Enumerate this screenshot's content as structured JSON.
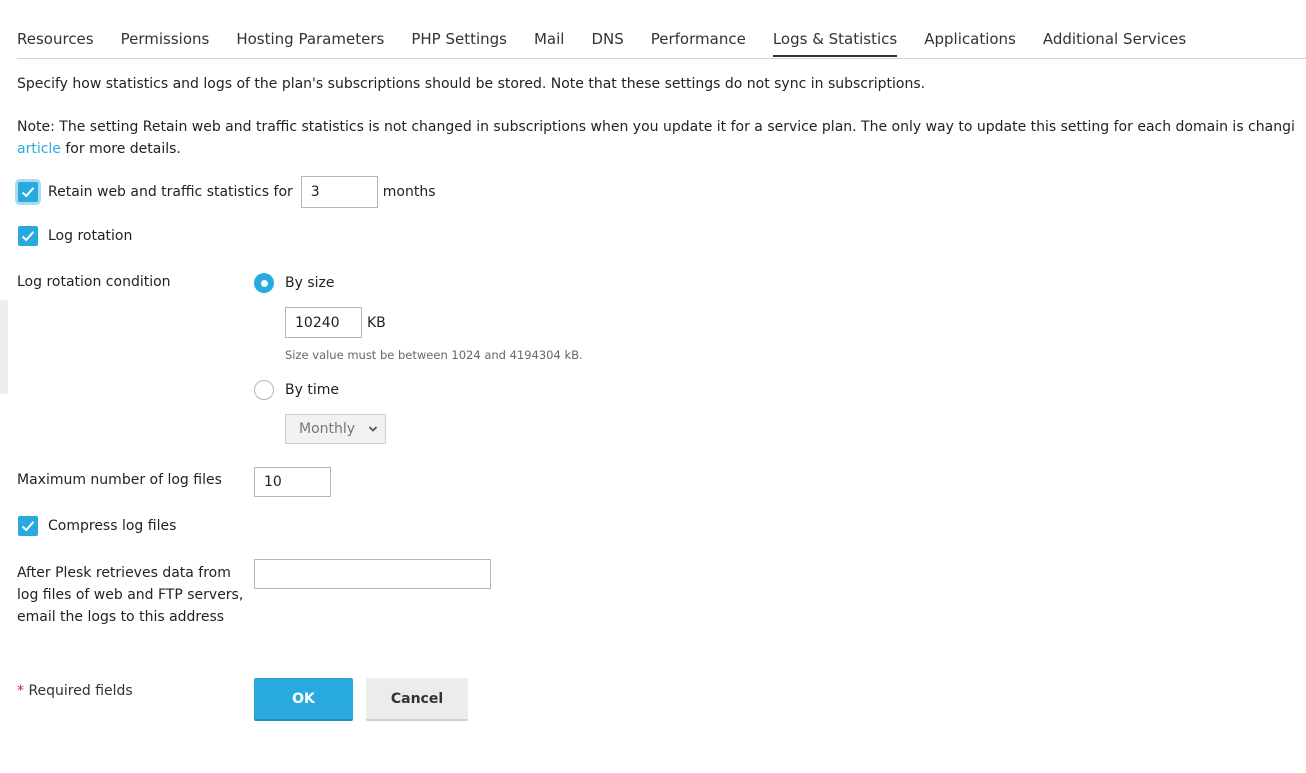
{
  "tabs": [
    {
      "label": "Resources"
    },
    {
      "label": "Permissions"
    },
    {
      "label": "Hosting Parameters"
    },
    {
      "label": "PHP Settings"
    },
    {
      "label": "Mail"
    },
    {
      "label": "DNS"
    },
    {
      "label": "Performance"
    },
    {
      "label": "Logs & Statistics",
      "active": true
    },
    {
      "label": "Applications"
    },
    {
      "label": "Additional Services"
    }
  ],
  "intro": "Specify how statistics and logs of the plan's subscriptions should be stored. Note that these settings do not sync in subscriptions.",
  "note": {
    "line1": "Note: The setting Retain web and traffic statistics is not changed in subscriptions when you update it for a service plan. The only way to update this setting for each domain is changi",
    "link": "article",
    "after_link": " for more details."
  },
  "retain": {
    "checked": true,
    "label": "Retain web and traffic statistics for",
    "value": "3",
    "unit": "months"
  },
  "log_rotation": {
    "checked": true,
    "label": "Log rotation"
  },
  "rotation_condition": {
    "label": "Log rotation condition",
    "by_size": {
      "label": "By size",
      "selected": true,
      "value": "10240",
      "unit": "KB",
      "hint": "Size value must be between 1024 and 4194304 kB."
    },
    "by_time": {
      "label": "By time",
      "selected": false,
      "select_value": "Monthly"
    }
  },
  "max_logs": {
    "label": "Maximum number of log files",
    "value": "10"
  },
  "compress": {
    "checked": true,
    "label": "Compress log files"
  },
  "email": {
    "label": "After Plesk retrieves data from log files of web and FTP servers, email the logs to this address",
    "value": ""
  },
  "required": {
    "star": "*",
    "label": " Required fields"
  },
  "buttons": {
    "ok": "OK",
    "cancel": "Cancel"
  },
  "colors": {
    "accent": "#28aade",
    "required_star": "#d02020"
  }
}
